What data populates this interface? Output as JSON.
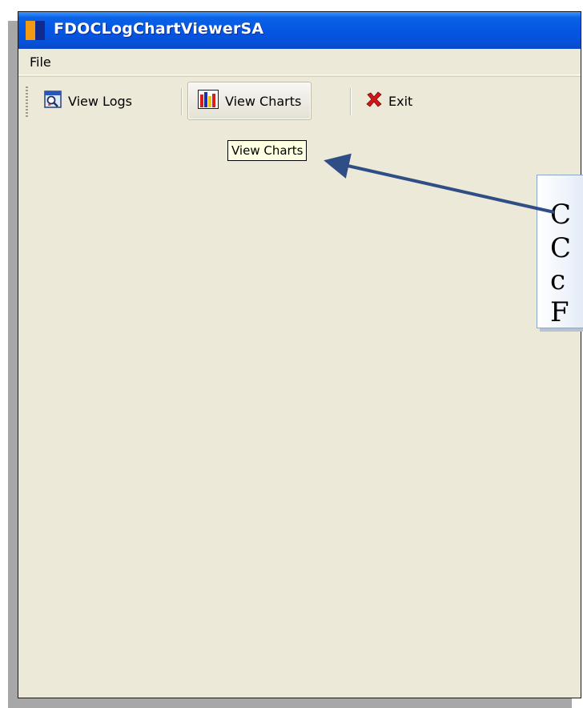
{
  "window": {
    "title": "FDOCLogChartViewerSA"
  },
  "menu": {
    "items": [
      {
        "label": "File"
      }
    ]
  },
  "toolbar": {
    "buttons": [
      {
        "label": "View Logs",
        "icon": "view-logs-icon",
        "pressed": false
      },
      {
        "label": "View Charts",
        "icon": "bar-chart-icon",
        "pressed": true
      },
      {
        "label": "Exit",
        "icon": "red-x-icon",
        "pressed": false
      }
    ]
  },
  "tooltip": {
    "text": "View Charts"
  },
  "callout": {
    "lines": [
      "C",
      "C",
      "c",
      "F"
    ]
  },
  "colors": {
    "titlebar": "#0554e3",
    "window_bg": "#ece9d8",
    "tooltip_bg": "#ffffe1",
    "arrow": "#2f4e85",
    "exit_icon": "#d01818"
  }
}
